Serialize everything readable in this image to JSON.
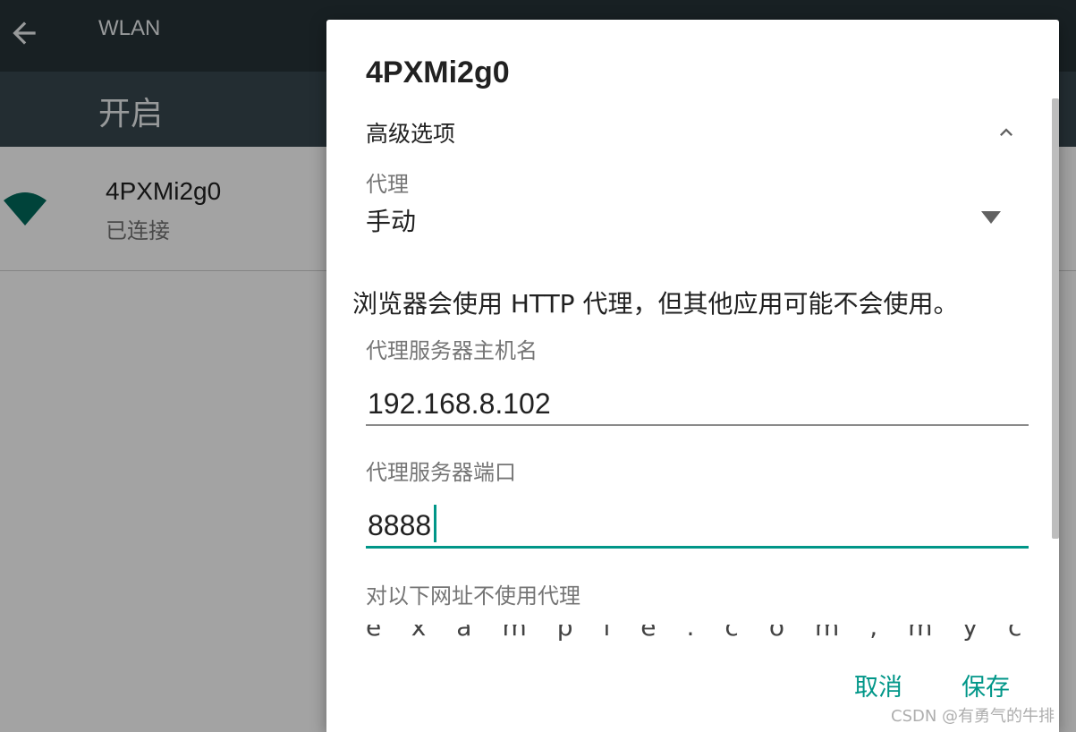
{
  "background": {
    "topbar_title": "WLAN",
    "switch_label": "开启",
    "network": {
      "name": "4PXMi2g0",
      "status": "已连接"
    },
    "icons": [
      "back-arrow-icon",
      "wifi-signal-icon"
    ]
  },
  "dialog": {
    "title": "4PXMi2g0",
    "advanced_label": "高级选项",
    "proxy": {
      "label": "代理",
      "value": "手动"
    },
    "notice": "浏览器会使用 HTTP 代理，但其他应用可能不会使用。",
    "host": {
      "label": "代理服务器主机名",
      "value": "192.168.8.102"
    },
    "port": {
      "label": "代理服务器端口",
      "value": "8888"
    },
    "bypass": {
      "label": "对以下网址不使用代理",
      "value": "example.com,mycomp.test.com,localhost"
    },
    "buttons": {
      "cancel": "取消",
      "save": "保存"
    }
  },
  "colors": {
    "accent": "#009688",
    "topbar": "#263238",
    "switchbar": "#37474f",
    "wifi_icon": "#00695c"
  },
  "watermark": "CSDN @有勇气的牛排"
}
